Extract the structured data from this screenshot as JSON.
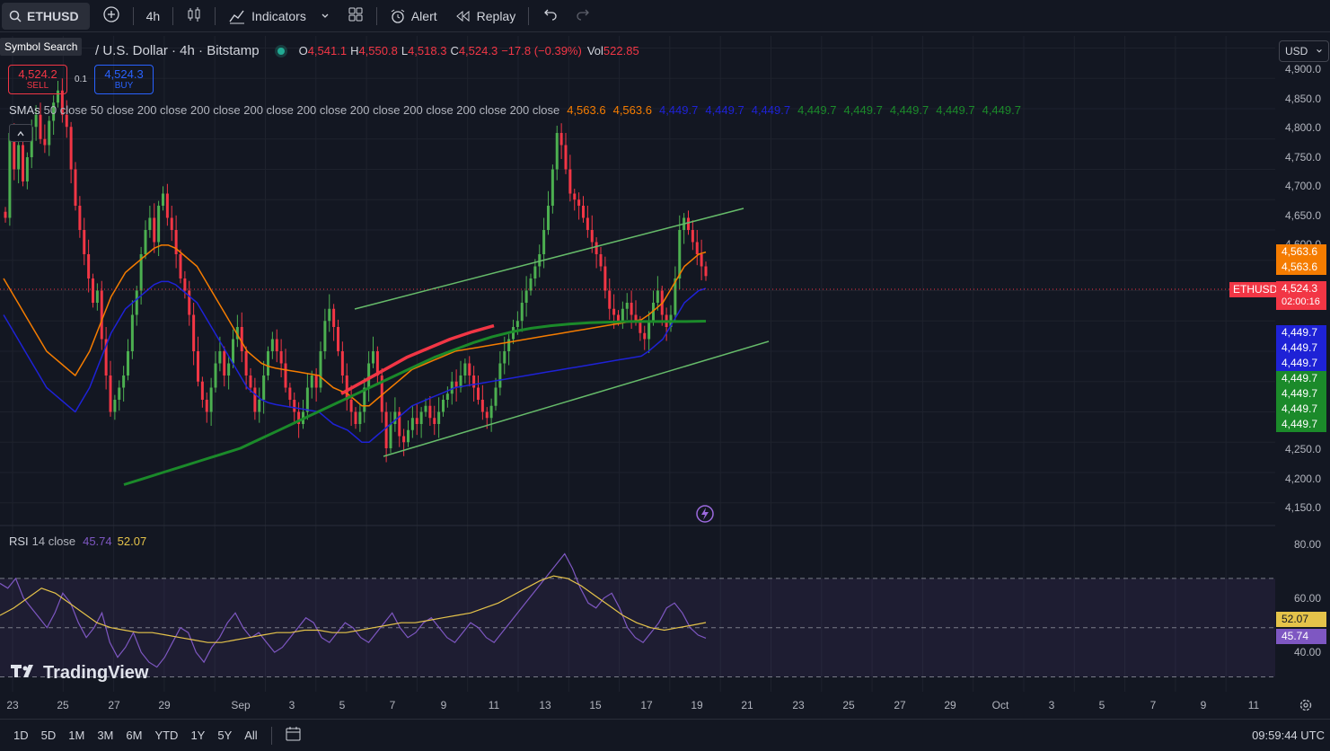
{
  "toolbar": {
    "symbol": "ETHUSD",
    "interval": "4h",
    "indicators_label": "Indicators",
    "alert_label": "Alert",
    "replay_label": "Replay"
  },
  "tooltip": "Symbol Search",
  "legend": {
    "title": "/ U.S. Dollar · 4h · Bitstamp",
    "o_label": "O",
    "o_value": "4,541.1",
    "h_label": "H",
    "h_value": "4,550.8",
    "l_label": "L",
    "l_value": "4,518.3",
    "c_label": "C",
    "c_value": "4,524.3",
    "change": "−17.8 (−0.39%)",
    "vol_label": "Vol",
    "vol_value": "522.85"
  },
  "trade": {
    "sell_price": "4,524.2",
    "sell_label": "SELL",
    "spread": "0.1",
    "buy_price": "4,524.3",
    "buy_label": "BUY"
  },
  "sma_legend": {
    "label": "SMAs",
    "params": "50 close 50 close 200 close 200 close 200 close 200 close 200 close 200 close 200 close 200 close",
    "values": [
      "4,563.6",
      "4,563.6",
      "4,449.7",
      "4,449.7",
      "4,449.7",
      "4,449.7",
      "4,449.7",
      "4,449.7",
      "4,449.7",
      "4,449.7"
    ]
  },
  "rsi_legend": {
    "label": "RSI",
    "params": "14 close",
    "rsi_value": "45.74",
    "ma_value": "52.07"
  },
  "currency": "USD",
  "price_axis": [
    "4,900.0",
    "4,850.0",
    "4,800.0",
    "4,750.0",
    "4,700.0",
    "4,650.0",
    "4,600.0",
    "4,250.0",
    "4,200.0",
    "4,150.0"
  ],
  "price_tags": {
    "sma50": [
      "4,563.6",
      "4,563.6"
    ],
    "symbol": "ETHUSD",
    "last": "4,524.3",
    "countdown": "02:00:16",
    "sma200": [
      "4,449.7",
      "4,449.7",
      "4,449.7",
      "4,449.7",
      "4,449.7",
      "4,449.7",
      "4,449.7"
    ]
  },
  "rsi_axis": [
    "80.00",
    "60.00",
    "40.00"
  ],
  "rsi_tags": {
    "ma": "52.07",
    "rsi": "45.74"
  },
  "time_axis": [
    "23",
    "25",
    "27",
    "29",
    "Sep",
    "3",
    "5",
    "7",
    "9",
    "11",
    "13",
    "15",
    "17",
    "19",
    "21",
    "23",
    "25",
    "27",
    "29",
    "Oct",
    "3",
    "5",
    "7",
    "9",
    "11"
  ],
  "ranges": [
    "1D",
    "5D",
    "1M",
    "3M",
    "6M",
    "YTD",
    "1Y",
    "5Y",
    "All"
  ],
  "clock": "09:59:44 UTC",
  "watermark": "TradingView",
  "colors": {
    "up": "#4caf50",
    "down": "#f23645",
    "sma50": "#f57c00",
    "sma200_blue": "#1e22d6",
    "sma200_green": "#1b8a2a",
    "rsi": "#7e57c2",
    "rsi_ma": "#e5c34a",
    "channel": "#66bb6a"
  },
  "chart_data": {
    "type": "candlestick",
    "y_range": [
      4120,
      4920
    ],
    "closes": [
      4620,
      4760,
      4700,
      4740,
      4680,
      4720,
      4770,
      4790,
      4750,
      4740,
      4780,
      4810,
      4830,
      4790,
      4770,
      4700,
      4640,
      4600,
      4560,
      4520,
      4480,
      4500,
      4420,
      4360,
      4300,
      4320,
      4340,
      4360,
      4400,
      4460,
      4500,
      4560,
      4600,
      4620,
      4580,
      4640,
      4660,
      4620,
      4600,
      4560,
      4520,
      4500,
      4460,
      4400,
      4350,
      4320,
      4300,
      4340,
      4380,
      4400,
      4360,
      4380,
      4420,
      4440,
      4400,
      4360,
      4340,
      4300,
      4320,
      4360,
      4400,
      4420,
      4400,
      4380,
      4340,
      4320,
      4300,
      4280,
      4300,
      4340,
      4360,
      4340,
      4400,
      4450,
      4470,
      4440,
      4400,
      4360,
      4320,
      4300,
      4280,
      4300,
      4340,
      4380,
      4400,
      4360,
      4300,
      4240,
      4280,
      4300,
      4260,
      4250,
      4270,
      4290,
      4280,
      4300,
      4310,
      4290,
      4280,
      4300,
      4320,
      4330,
      4350,
      4340,
      4360,
      4380,
      4360,
      4340,
      4320,
      4300,
      4290,
      4310,
      4340,
      4380,
      4400,
      4420,
      4440,
      4450,
      4480,
      4500,
      4520,
      4540,
      4560,
      4600,
      4640,
      4700,
      4760,
      4740,
      4700,
      4660,
      4650,
      4640,
      4620,
      4600,
      4580,
      4560,
      4540,
      4500,
      4470,
      4460,
      4450,
      4470,
      4480,
      4460,
      4450,
      4430,
      4420,
      4450,
      4480,
      4500,
      4460,
      4440,
      4460,
      4520,
      4600,
      4620,
      4600,
      4580,
      4560,
      4540,
      4524
    ],
    "sma50": [
      4520,
      4500,
      4480,
      4460,
      4440,
      4420,
      4400,
      4390,
      4380,
      4370,
      4360,
      4380,
      4400,
      4430,
      4460,
      4490,
      4510,
      4530,
      4540,
      4550,
      4560,
      4570,
      4575,
      4575,
      4570,
      4560,
      4550,
      4540,
      4520,
      4500,
      4480,
      4460,
      4440,
      4420,
      4400,
      4390,
      4380,
      4375,
      4372,
      4370,
      4368,
      4366,
      4364,
      4362,
      4360,
      4350,
      4340,
      4335,
      4330,
      4320,
      4310,
      4310,
      4320,
      4330,
      4340,
      4350,
      4360,
      4370,
      4375,
      4380,
      4385,
      4390,
      4395,
      4400,
      4402,
      4404,
      4406,
      4408,
      4410,
      4412,
      4414,
      4416,
      4418,
      4420,
      4422,
      4424,
      4426,
      4428,
      4430,
      4432,
      4434,
      4436,
      4438,
      4440,
      4442,
      4444,
      4446,
      4448,
      4450,
      4452,
      4460,
      4470,
      4480,
      4500,
      4520,
      4540,
      4550,
      4560,
      4563.6
    ],
    "sma200": [
      4180,
      4190,
      4200,
      4210,
      4220,
      4230,
      4240,
      4255,
      4270,
      4285,
      4300,
      4315,
      4330,
      4345,
      4360,
      4375,
      4390,
      4402,
      4414,
      4424,
      4432,
      4438,
      4442,
      4445,
      4447,
      4448,
      4449,
      4449,
      4449,
      4449,
      4449.7
    ],
    "rsi": [
      68,
      66,
      70,
      62,
      58,
      54,
      50,
      56,
      64,
      60,
      52,
      46,
      50,
      56,
      44,
      38,
      42,
      48,
      40,
      36,
      34,
      38,
      44,
      50,
      48,
      40,
      36,
      42,
      46,
      52,
      56,
      50,
      46,
      48,
      44,
      40,
      42,
      46,
      50,
      54,
      52,
      46,
      44,
      48,
      52,
      50,
      46,
      44,
      48,
      52,
      56,
      50,
      46,
      48,
      52,
      54,
      50,
      46,
      44,
      48,
      52,
      50,
      46,
      44,
      48,
      52,
      56,
      60,
      64,
      68,
      72,
      76,
      80,
      74,
      66,
      60,
      58,
      62,
      64,
      58,
      50,
      46,
      44,
      48,
      52,
      58,
      60,
      56,
      50,
      47,
      45.74
    ],
    "rsi_ma": [
      55,
      58,
      62,
      66,
      64,
      60,
      56,
      52,
      50,
      49,
      48,
      48,
      47,
      46,
      45,
      44,
      44,
      45,
      46,
      47,
      48,
      48,
      49,
      49,
      48,
      48,
      49,
      50,
      51,
      52,
      52,
      53,
      54,
      55,
      56,
      58,
      60,
      63,
      66,
      69,
      71,
      70,
      67,
      63,
      59,
      55,
      52,
      50,
      49,
      50,
      51,
      52.07
    ],
    "rsi_levels": [
      70,
      50,
      30
    ],
    "rsi_range": [
      24,
      86
    ]
  }
}
